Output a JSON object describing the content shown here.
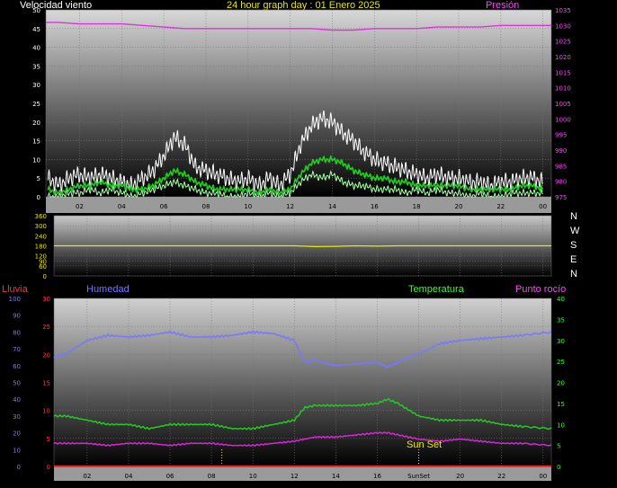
{
  "header": {
    "left": "Velocidad viento",
    "center": "24 hour graph day : 01 Enero 2025",
    "right": "Presión"
  },
  "compass": [
    "N",
    "W",
    "S",
    "E",
    "N"
  ],
  "bottom_labels": {
    "rain": "Lluvia",
    "humidity": "Humedad",
    "temperature": "Temperatura",
    "dewpoint": "Punto rocío",
    "sunset": "Sun Set",
    "sunset_axis": "SunSet"
  },
  "colors": {
    "wind_gust": "#ffffff",
    "wind_avg": "#22cc22",
    "wind_avg_light": "#aaffaa",
    "pressure": "#dd33dd",
    "direction": "#e8e800",
    "humidity": "#7777ff",
    "temperature": "#22cc22",
    "dewpoint": "#dd22dd",
    "rain": "#ff2222",
    "rain_axis": "#ff3333",
    "humidity_axis": "#7777ff",
    "temp_axis": "#33ff33",
    "pressure_axis": "#ff44ff",
    "text_yellow": "#e8e800"
  },
  "chart_data": [
    {
      "type": "line",
      "name": "wind-pressure",
      "x_ticks": [
        "02",
        "04",
        "06",
        "08",
        "10",
        "12",
        "14",
        "16",
        "18",
        "20",
        "22",
        "00"
      ],
      "x_tick_hours": [
        2,
        4,
        6,
        8,
        10,
        12,
        14,
        16,
        18,
        20,
        22,
        24
      ],
      "ylabel_left": "Velocidad viento",
      "ylabel_right": "Presión",
      "ylim_left": [
        0,
        50
      ],
      "yticks_left": [
        0,
        5,
        10,
        15,
        20,
        25,
        30,
        35,
        40,
        45,
        50
      ],
      "ylim_right": [
        975,
        1035
      ],
      "yticks_right": [
        975,
        980,
        985,
        990,
        995,
        1000,
        1005,
        1010,
        1015,
        1020,
        1025,
        1030,
        1035
      ],
      "xlim_hours": [
        0.4,
        24.4
      ],
      "series": [
        {
          "key": "gust",
          "x": [
            0.5,
            1,
            1.5,
            2,
            2.5,
            3,
            3.5,
            4,
            4.5,
            5,
            5.5,
            6,
            6.5,
            7,
            7.5,
            8,
            8.5,
            9,
            9.5,
            10,
            10.5,
            11,
            11.5,
            12,
            12.5,
            13,
            13.5,
            14,
            14.5,
            15,
            15.5,
            16,
            16.5,
            17,
            17.5,
            18,
            18.5,
            19,
            19.5,
            20,
            20.5,
            21,
            21.5,
            22,
            22.5,
            23,
            23.5,
            24
          ],
          "y": [
            5,
            3,
            5,
            6,
            5,
            6,
            5,
            4,
            3,
            5,
            7,
            11,
            16,
            14,
            8,
            7,
            6,
            5,
            4,
            5,
            3,
            5,
            3,
            6,
            14,
            19,
            21,
            20,
            17,
            15,
            12,
            10,
            9,
            8,
            7,
            6,
            5,
            6,
            5,
            5,
            4,
            4,
            3,
            4,
            4,
            5,
            5,
            4
          ]
        },
        {
          "key": "gust_min",
          "x": [
            0.5,
            1,
            1.5,
            2,
            2.5,
            3,
            3.5,
            4,
            4.5,
            5,
            5.5,
            6,
            6.5,
            7,
            7.5,
            8,
            8.5,
            9,
            9.5,
            10,
            10.5,
            11,
            11.5,
            12,
            12.5,
            13,
            13.5,
            14,
            14.5,
            15,
            15.5,
            16,
            16.5,
            17,
            17.5,
            18,
            18.5,
            19,
            19.5,
            20,
            20.5,
            21,
            21.5,
            22,
            22.5,
            23,
            23.5,
            24
          ],
          "y": [
            0,
            0,
            1,
            1,
            2,
            1,
            2,
            1,
            0,
            1,
            2,
            3,
            4,
            3,
            2,
            1,
            1,
            0,
            0,
            1,
            0,
            1,
            0,
            1,
            4,
            6,
            5,
            6,
            4,
            3,
            3,
            2,
            2,
            2,
            1,
            2,
            1,
            2,
            1,
            1,
            0,
            1,
            0,
            0,
            1,
            1,
            1,
            1
          ]
        },
        {
          "key": "avg",
          "x": [
            0.5,
            1,
            1.5,
            2,
            2.5,
            3,
            3.5,
            4,
            4.5,
            5,
            5.5,
            6,
            6.5,
            7,
            7.5,
            8,
            8.5,
            9,
            9.5,
            10,
            10.5,
            11,
            11.5,
            12,
            12.5,
            13,
            13.5,
            14,
            14.5,
            15,
            15.5,
            16,
            16.5,
            17,
            17.5,
            18,
            18.5,
            19,
            19.5,
            20,
            20.5,
            21,
            21.5,
            22,
            22.5,
            23,
            23.5,
            24
          ],
          "y": [
            2,
            1,
            2,
            3,
            3,
            4,
            3,
            3,
            2,
            2,
            3,
            5,
            7,
            6,
            4,
            3,
            2,
            2,
            2,
            2,
            1,
            2,
            1,
            2,
            6,
            9,
            10,
            10,
            9,
            7,
            6,
            5,
            5,
            4,
            4,
            3,
            3,
            3,
            3,
            3,
            2,
            2,
            2,
            2,
            2,
            3,
            3,
            2
          ]
        },
        {
          "key": "pressure",
          "x": [
            0.4,
            1,
            2,
            3,
            4,
            5,
            6,
            7,
            8,
            9,
            10,
            11,
            12,
            13,
            14,
            15,
            16,
            17,
            18,
            19,
            20,
            21,
            22,
            23,
            24.4
          ],
          "y": [
            1031,
            1031,
            1030.5,
            1030.5,
            1030.5,
            1030,
            1029.5,
            1029,
            1029,
            1029,
            1029,
            1029,
            1029,
            1029,
            1028.5,
            1028.5,
            1029,
            1029,
            1029,
            1029.5,
            1029.5,
            1029.5,
            1030,
            1030,
            1030
          ]
        }
      ]
    },
    {
      "type": "line",
      "name": "wind-direction",
      "ylim": [
        0,
        360
      ],
      "yticks": [
        0,
        60,
        90,
        120,
        180,
        240,
        300,
        360
      ],
      "series": [
        {
          "key": "direction",
          "x": [
            0.4,
            12,
            13,
            14,
            15,
            16,
            17,
            24.4
          ],
          "y": [
            180,
            180,
            175,
            177,
            180,
            178,
            180,
            180
          ]
        }
      ]
    },
    {
      "type": "line",
      "name": "temperature-humidity",
      "x_ticks": [
        "02",
        "04",
        "06",
        "08",
        "10",
        "12",
        "14",
        "16",
        "SunSet",
        "20",
        "22",
        "00"
      ],
      "xlim_hours": [
        0.4,
        24.4
      ],
      "ylabel_left_1": "Lluvia",
      "ylabel_left_2": "Humedad",
      "ylabel_right_1": "Temperatura",
      "ylabel_right_2": "Punto rocío",
      "ylim_rain": [
        0,
        30
      ],
      "yticks_rain": [
        0,
        5,
        10,
        15,
        20,
        25,
        30
      ],
      "ylim_humidity": [
        0,
        100
      ],
      "yticks_humidity": [
        0,
        10,
        20,
        30,
        40,
        50,
        60,
        70,
        80,
        90,
        100
      ],
      "ylim_temp": [
        0,
        40
      ],
      "yticks_temp": [
        0,
        5,
        10,
        15,
        20,
        25,
        30,
        35,
        40
      ],
      "markers_hours": [
        8.5,
        18.0
      ],
      "series": [
        {
          "key": "humidity",
          "x": [
            0.4,
            1,
            2,
            3,
            4,
            5,
            6,
            7,
            8,
            9,
            10,
            11,
            12,
            12.5,
            13,
            14,
            15,
            16,
            16.5,
            17,
            18,
            19,
            20,
            21,
            22,
            23,
            24.4
          ],
          "y": [
            65,
            67,
            75,
            78,
            77,
            78,
            80,
            77,
            77,
            78,
            80,
            79,
            75,
            62,
            63,
            60,
            61,
            62,
            59,
            62,
            67,
            73,
            75,
            76,
            77,
            78,
            80
          ]
        },
        {
          "key": "temperature",
          "x": [
            0.4,
            1,
            2,
            3,
            4,
            5,
            6,
            7,
            8,
            9,
            10,
            11,
            12,
            12.5,
            13,
            14,
            15,
            16,
            16.5,
            17,
            18,
            19,
            20,
            21,
            22,
            23,
            24.4
          ],
          "y": [
            12,
            12,
            11,
            10,
            10,
            9,
            10,
            10,
            10,
            9,
            9,
            10,
            11,
            14,
            14.5,
            14.5,
            14.5,
            15,
            16,
            15,
            12,
            11,
            11,
            11,
            10,
            9.5,
            9
          ]
        },
        {
          "key": "dewpoint",
          "x": [
            0.4,
            1,
            2,
            3,
            4,
            5,
            6,
            7,
            8,
            9,
            10,
            11,
            12,
            13,
            14,
            15,
            16,
            16.5,
            17,
            18,
            19,
            20,
            21,
            22,
            23,
            24.4
          ],
          "y": [
            5.5,
            5.5,
            5.5,
            5,
            5.5,
            5.5,
            5,
            5.5,
            5.5,
            5,
            5,
            5.5,
            6,
            7,
            7,
            7.5,
            8,
            8,
            7.5,
            6.5,
            6,
            6.5,
            6,
            5.5,
            5.5,
            5
          ]
        },
        {
          "key": "rain",
          "x": [
            0.4,
            24.4
          ],
          "y": [
            0,
            0
          ]
        }
      ]
    }
  ]
}
